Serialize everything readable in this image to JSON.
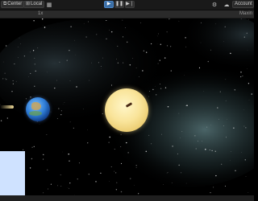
{
  "toolbar": {
    "center_label": "Center",
    "local_label": "Local",
    "account_label": "Account"
  },
  "scene": {
    "zoom_label": "1x",
    "maximize_label": "Maxin"
  },
  "colors": {
    "play_accent": "#3a6ea5",
    "toolbar_bg": "#191919",
    "panel_bg": "#cfe2ff",
    "sun": "#f9e49a"
  }
}
